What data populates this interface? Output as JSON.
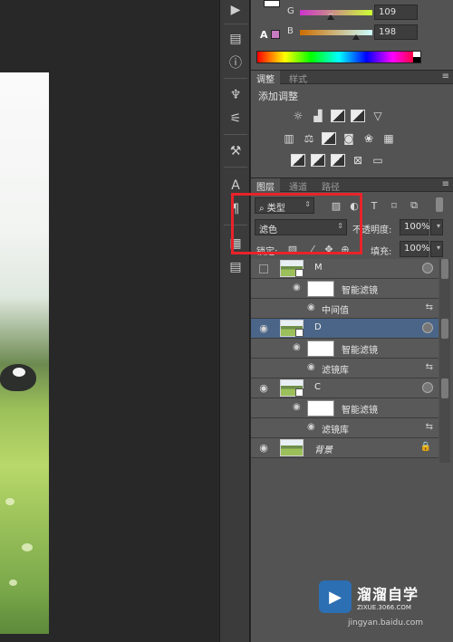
{
  "color_panel": {
    "channels": [
      {
        "label": "G",
        "value": "109",
        "gradient": [
          "#cc33cc",
          "#ccff33"
        ],
        "thumb_level": 0.43
      },
      {
        "label": "B",
        "value": "198",
        "gradient": [
          "#cc6d00",
          "#ccffff"
        ],
        "thumb_level": 0.78
      }
    ],
    "warning_icon": "A",
    "current_color": "#c86dc6"
  },
  "adjustments_panel": {
    "tabs": [
      "调整",
      "样式"
    ],
    "title": "添加调整",
    "icons": [
      [
        "brightness-icon",
        "levels-icon",
        "curves-icon",
        "exposure-icon",
        "vibrance-icon"
      ],
      [
        "hue-saturation-icon",
        "color-balance-icon",
        "black-white-icon",
        "photo-filter-icon",
        "channel-mixer-icon",
        "color-lookup-icon"
      ],
      [
        "invert-icon",
        "posterize-icon",
        "threshold-icon",
        "selective-color-icon",
        "gradient-map-icon"
      ]
    ]
  },
  "layers_panel": {
    "tabs": [
      "图层",
      "通道",
      "路径"
    ],
    "filter_kind": "类型",
    "blend_mode": "滤色",
    "opacity_label": "不透明度:",
    "opacity_value": "100%",
    "lock_label": "锁定:",
    "fill_label": "填充:",
    "fill_value": "100%",
    "layers": [
      {
        "name": "M",
        "visible": false,
        "selected": false,
        "filter_label": "智能滤镜",
        "filter_name": "中间值"
      },
      {
        "name": "D",
        "visible": true,
        "selected": true,
        "filter_label": "智能滤镜",
        "filter_name": "滤镜库"
      },
      {
        "name": "C",
        "visible": true,
        "selected": false,
        "filter_label": "智能滤镜",
        "filter_name": "滤镜库"
      },
      {
        "name": "背景",
        "visible": true,
        "selected": false,
        "locked": true
      }
    ]
  },
  "watermark": {
    "title": "溜溜自学",
    "url": "ZIXUE.3066.COM",
    "source": "jingyan.baidu.com"
  },
  "highlight_color": "#e8232a"
}
